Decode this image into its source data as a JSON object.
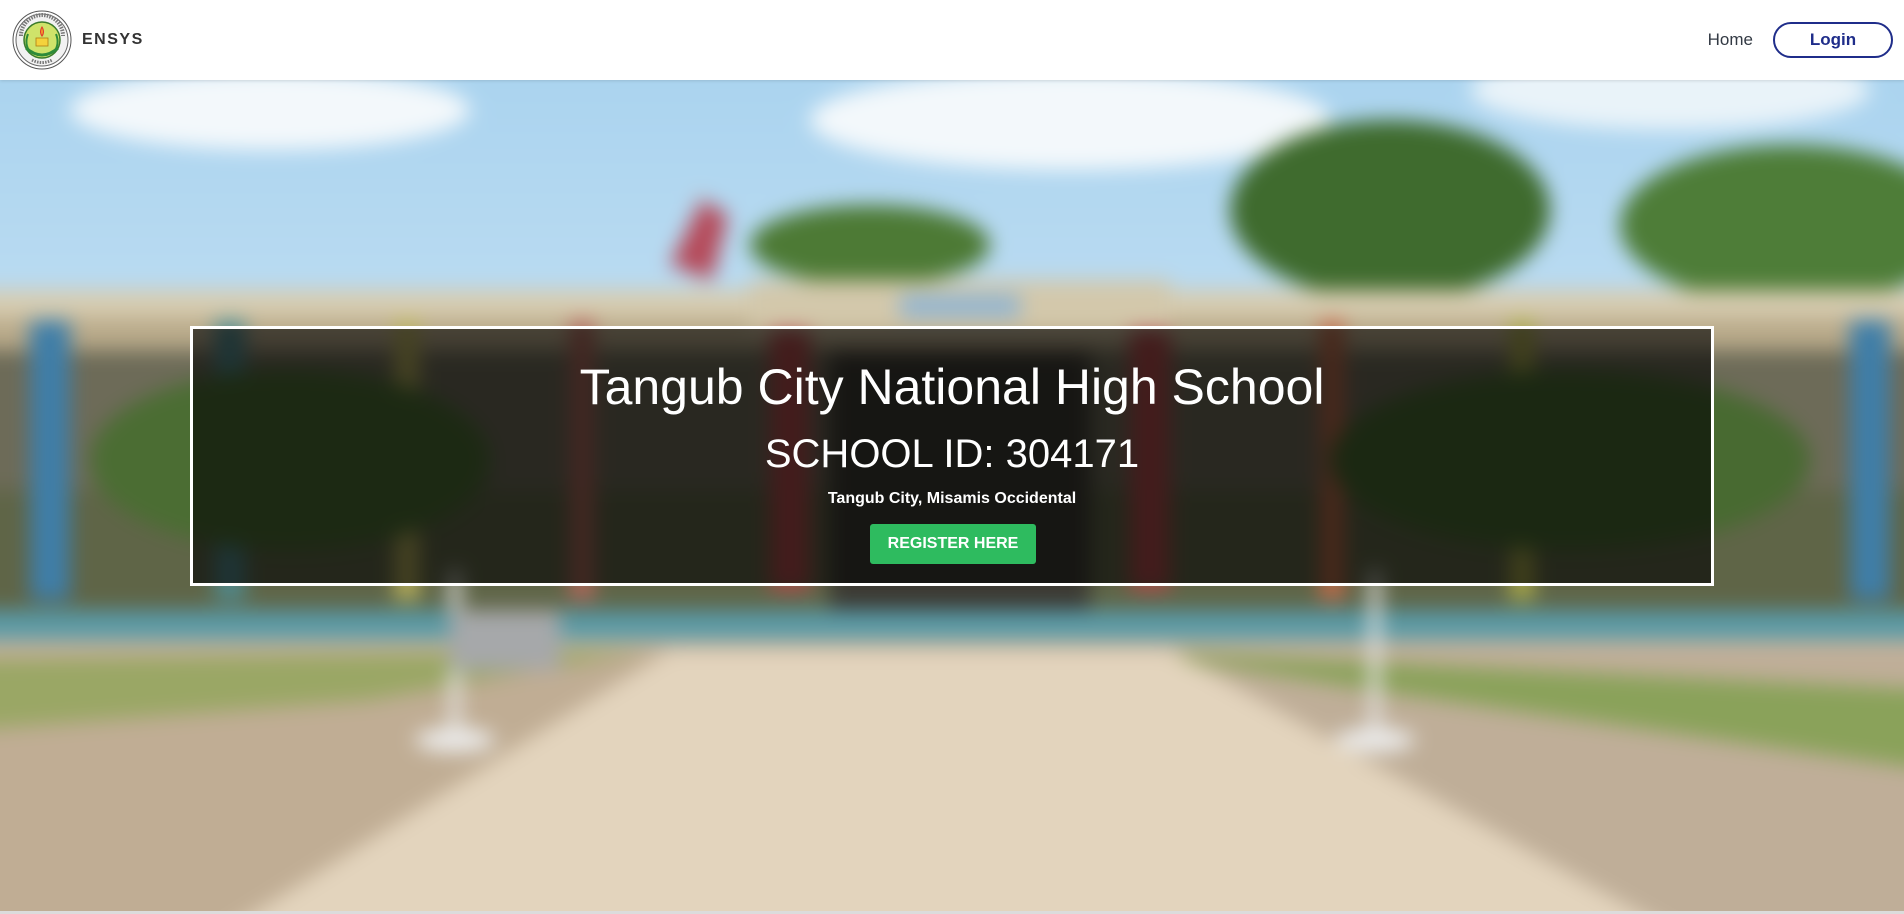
{
  "navbar": {
    "brand": "ENSYS",
    "logo_icon": "school-seal-icon",
    "links": {
      "home": "Home",
      "login": "Login"
    }
  },
  "hero": {
    "background": "blurred photo of school building and walkway",
    "school_name": "Tangub City National High School",
    "school_id": "SCHOOL ID: 304171",
    "location": "Tangub City, Misamis Occidental",
    "register_label": "REGISTER HERE"
  },
  "colors": {
    "login_accent": "#1f2d8a",
    "register_green": "#2ebb5f",
    "overlay": "rgba(0,0,0,0.62)"
  }
}
